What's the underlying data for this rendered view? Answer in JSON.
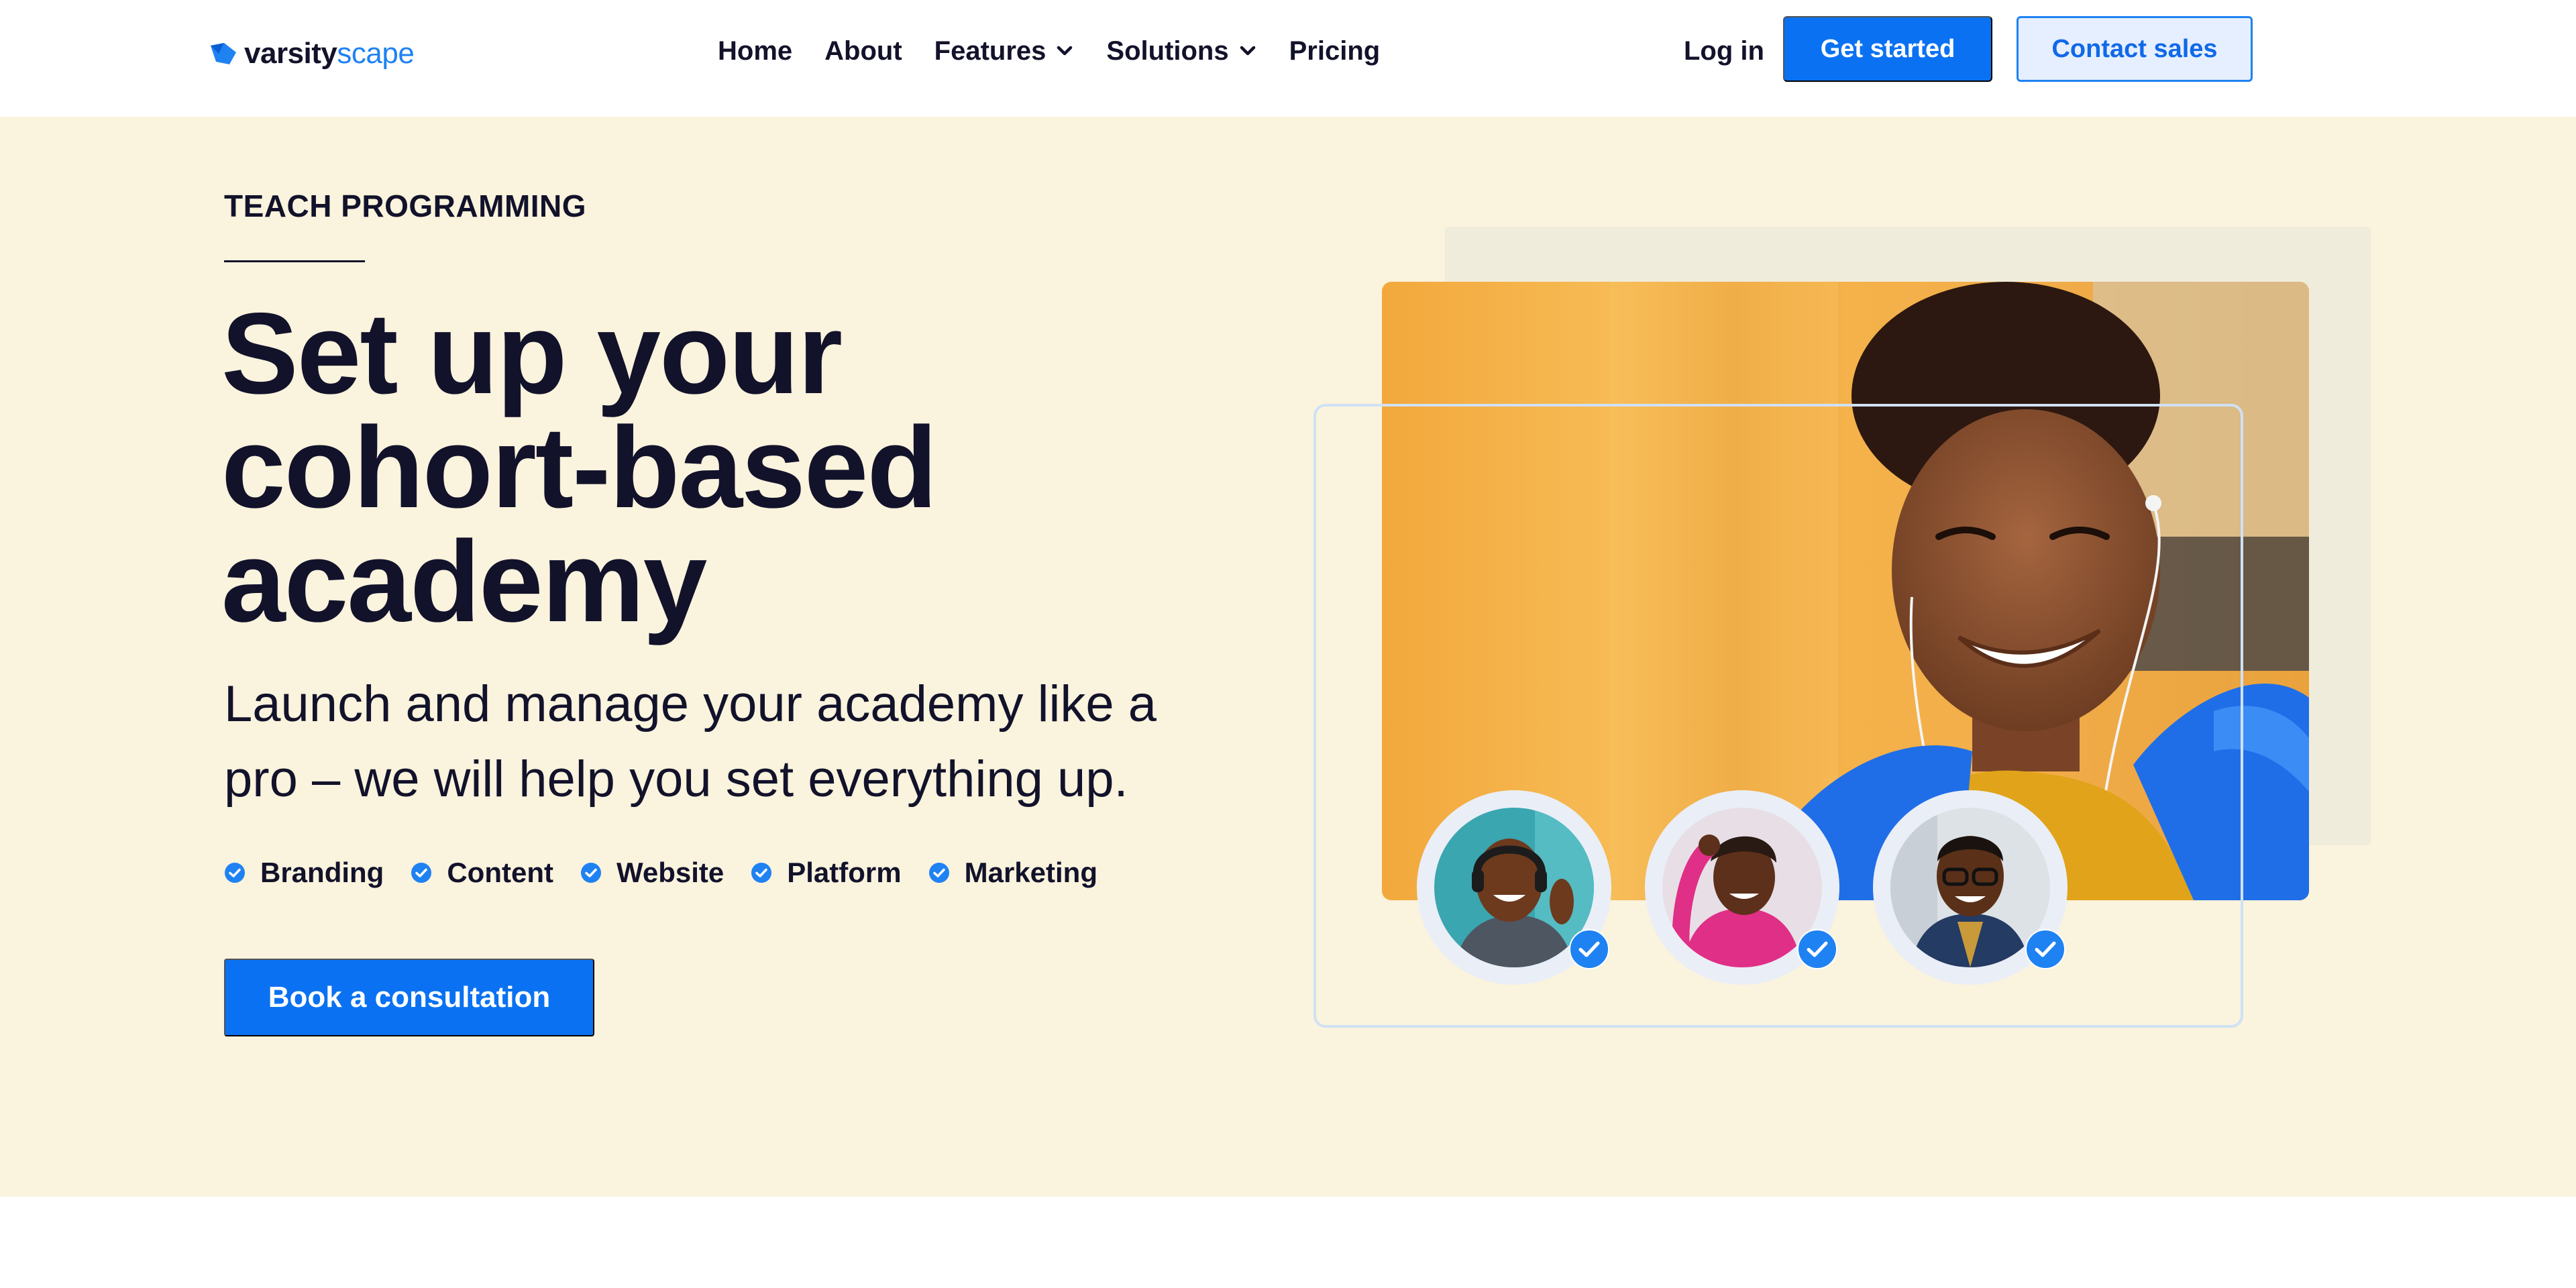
{
  "brand": {
    "name_primary": "varsity",
    "name_accent": "scape",
    "accent_color": "#1f82f2"
  },
  "nav": {
    "items": [
      {
        "label": "Home"
      },
      {
        "label": "About"
      },
      {
        "label": "Features",
        "has_dropdown": true
      },
      {
        "label": "Solutions",
        "has_dropdown": true
      },
      {
        "label": "Pricing"
      }
    ],
    "login_label": "Log in",
    "get_started_label": "Get started",
    "contact_sales_label": "Contact sales"
  },
  "hero": {
    "eyebrow": "TEACH PROGRAMMING",
    "headline": "Set up your cohort-based academy",
    "subline": "Launch and manage your academy like a pro – we will help you set everything up.",
    "features": [
      "Branding",
      "Content",
      "Website",
      "Platform",
      "Marketing"
    ],
    "cta_label": "Book a consultation",
    "background_color": "#faf3dd",
    "primary_color": "#0a72f2"
  },
  "icons": {
    "logo": "leaf-logo-icon",
    "dropdown": "chevron-down-icon",
    "feature_check": "check-circle-icon",
    "verified": "verified-badge-icon"
  }
}
